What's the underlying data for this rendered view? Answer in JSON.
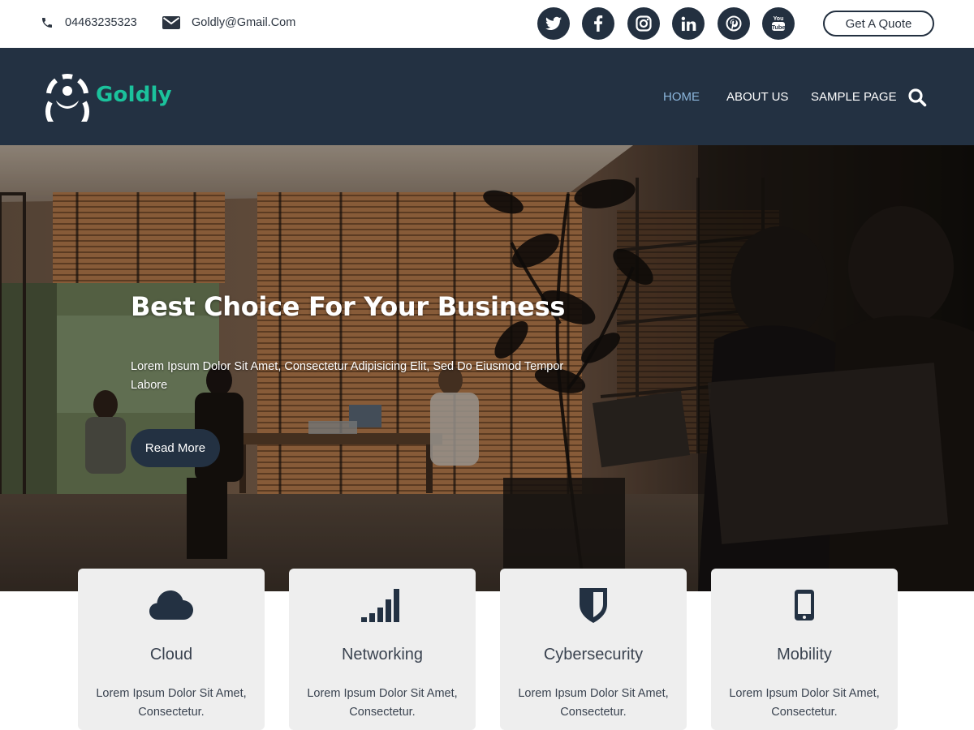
{
  "topbar": {
    "phone": "04463235323",
    "email": "Goldly@Gmail.Com",
    "social_icons": [
      "twitter-icon",
      "facebook-icon",
      "instagram-icon",
      "linkedin-icon",
      "pinterest-icon",
      "youtube-icon"
    ],
    "quote_button": "Get A Quote"
  },
  "header": {
    "logo_text": "Goldly",
    "nav": [
      "HOME",
      "ABOUT US",
      "SAMPLE PAGE"
    ],
    "active_nav": "HOME"
  },
  "hero": {
    "title": "Best Choice For Your Business",
    "subtitle": "Lorem Ipsum Dolor Sit Amet, Consectetur Adipisicing Elit, Sed Do Eiusmod Tempor Labore",
    "button": "Read More"
  },
  "services": [
    {
      "icon": "cloud-icon",
      "title": "Cloud",
      "desc": "Lorem Ipsum Dolor Sit Amet, Consectetur."
    },
    {
      "icon": "signal-bars-icon",
      "title": "Networking",
      "desc": "Lorem Ipsum Dolor Sit Amet, Consectetur."
    },
    {
      "icon": "shield-icon",
      "title": "Cybersecurity",
      "desc": "Lorem Ipsum Dolor Sit Amet, Consectetur."
    },
    {
      "icon": "mobile-icon",
      "title": "Mobility",
      "desc": "Lorem Ipsum Dolor Sit Amet, Consectetur."
    }
  ],
  "colors": {
    "dark_navy": "#233142",
    "brand_green": "#1bc29c",
    "active_nav": "#8cb6dc",
    "card_bg": "#eeeeee"
  }
}
